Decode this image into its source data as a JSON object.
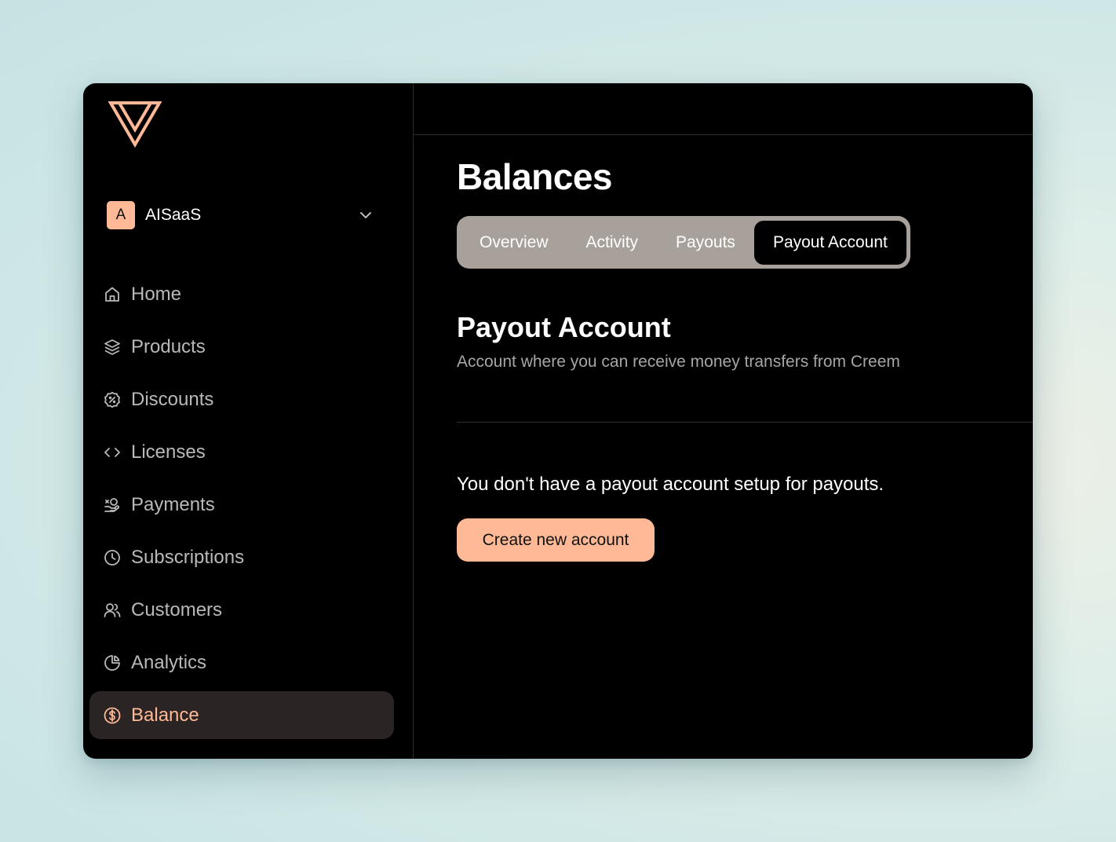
{
  "colors": {
    "accent": "#ffb996",
    "background": "#000000",
    "tabs_bg": "#a8a19b",
    "active_nav_bg": "#2b2424"
  },
  "workspace": {
    "avatar_letter": "A",
    "name": "AISaaS"
  },
  "sidebar": {
    "items": [
      {
        "label": "Home",
        "icon": "home-icon"
      },
      {
        "label": "Products",
        "icon": "layers-icon"
      },
      {
        "label": "Discounts",
        "icon": "discount-badge-icon"
      },
      {
        "label": "Licenses",
        "icon": "code-icon"
      },
      {
        "label": "Payments",
        "icon": "payments-icon"
      },
      {
        "label": "Subscriptions",
        "icon": "clock-icon"
      },
      {
        "label": "Customers",
        "icon": "users-icon"
      },
      {
        "label": "Analytics",
        "icon": "pie-chart-icon"
      },
      {
        "label": "Balance",
        "icon": "dollar-circle-icon",
        "active": true
      }
    ]
  },
  "main": {
    "title": "Balances",
    "tabs": [
      {
        "label": "Overview"
      },
      {
        "label": "Activity"
      },
      {
        "label": "Payouts"
      },
      {
        "label": "Payout Account",
        "active": true
      }
    ],
    "section": {
      "title": "Payout Account",
      "subtitle": "Account where you can receive money transfers from Creem"
    },
    "empty_message": "You don't have a payout account setup for payouts.",
    "create_button": "Create new account"
  }
}
